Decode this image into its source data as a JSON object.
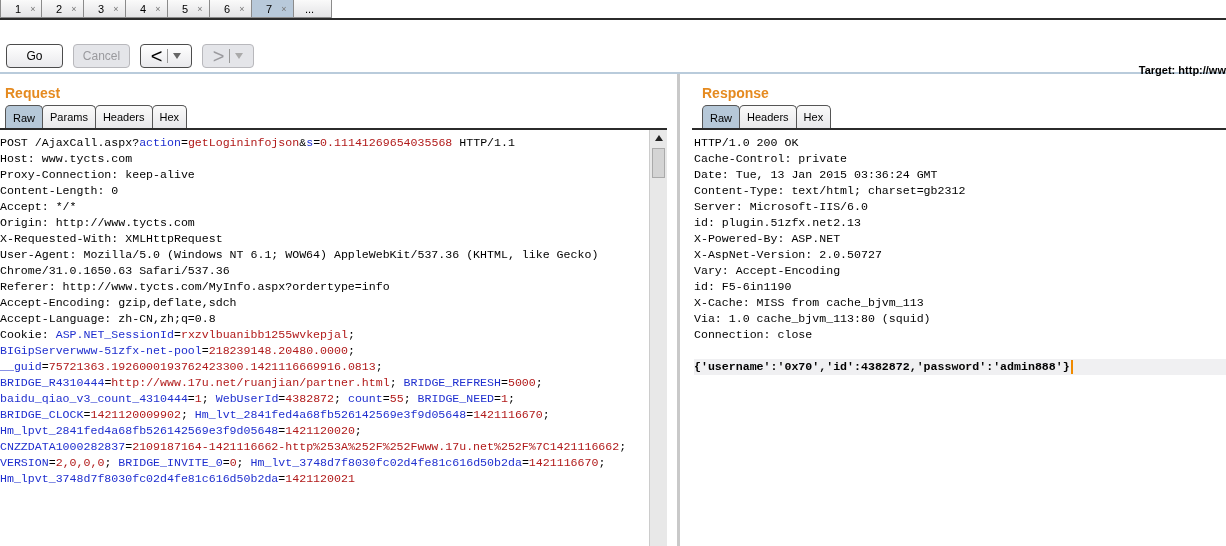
{
  "tabs": [
    {
      "label": "1",
      "close": "×",
      "selected": false
    },
    {
      "label": "2",
      "close": "×",
      "selected": false
    },
    {
      "label": "3",
      "close": "×",
      "selected": false
    },
    {
      "label": "4",
      "close": "×",
      "selected": false
    },
    {
      "label": "5",
      "close": "×",
      "selected": false
    },
    {
      "label": "6",
      "close": "×",
      "selected": false
    },
    {
      "label": "7",
      "close": "×",
      "selected": true
    },
    {
      "label": "...",
      "selected": false
    }
  ],
  "toolbar": {
    "buttons": [
      {
        "kind": "text",
        "label": "Go",
        "disabled": false
      },
      {
        "kind": "text",
        "label": "Cancel",
        "disabled": true
      },
      {
        "kind": "history",
        "label": "<",
        "disabled": false
      },
      {
        "kind": "history",
        "label": ">",
        "disabled": true
      }
    ],
    "target": "Target: http://ww"
  },
  "request": {
    "title": "Request",
    "tabs": [
      {
        "label": "Raw",
        "selected": true
      },
      {
        "label": "Params",
        "selected": false
      },
      {
        "label": "Headers",
        "selected": false
      },
      {
        "label": "Hex",
        "selected": false
      }
    ],
    "lines": [
      [
        {
          "kind": "plain",
          "text": "POST /AjaxCall.aspx?"
        },
        {
          "kind": "name",
          "text": "action"
        },
        {
          "kind": "plain",
          "text": "="
        },
        {
          "kind": "value",
          "text": "getLogininfojson"
        },
        {
          "kind": "plain",
          "text": "&"
        },
        {
          "kind": "name",
          "text": "s"
        },
        {
          "kind": "plain",
          "text": "="
        },
        {
          "kind": "value",
          "text": "0.11141269654035568"
        },
        {
          "kind": "plain",
          "text": " HTTP/1.1"
        }
      ],
      [
        {
          "kind": "plain",
          "text": "Host: www.tycts.com"
        }
      ],
      [
        {
          "kind": "plain",
          "text": "Proxy-Connection: keep-alive"
        }
      ],
      [
        {
          "kind": "plain",
          "text": "Content-Length: 0"
        }
      ],
      [
        {
          "kind": "plain",
          "text": "Accept: */*"
        }
      ],
      [
        {
          "kind": "plain",
          "text": "Origin: http://www.tycts.com"
        }
      ],
      [
        {
          "kind": "plain",
          "text": "X-Requested-With: XMLHttpRequest"
        }
      ],
      [
        {
          "kind": "plain",
          "text": "User-Agent: Mozilla/5.0 (Windows NT 6.1; WOW64) AppleWebKit/537.36 (KHTML, like Gecko)"
        }
      ],
      [
        {
          "kind": "plain",
          "text": "Chrome/31.0.1650.63 Safari/537.36"
        }
      ],
      [
        {
          "kind": "plain",
          "text": "Referer: http://www.tycts.com/MyInfo.aspx?ordertype=info"
        }
      ],
      [
        {
          "kind": "plain",
          "text": "Accept-Encoding: gzip,deflate,sdch"
        }
      ],
      [
        {
          "kind": "plain",
          "text": "Accept-Language: zh-CN,zh;q=0.8"
        }
      ],
      [
        {
          "kind": "plain",
          "text": "Cookie: "
        },
        {
          "kind": "name",
          "text": "ASP.NET_SessionId"
        },
        {
          "kind": "plain",
          "text": "="
        },
        {
          "kind": "value",
          "text": "rxzvlbuanibb1255wvkepjal"
        },
        {
          "kind": "plain",
          "text": ";"
        }
      ],
      [
        {
          "kind": "name",
          "text": "BIGipServerwww-51zfx-net-pool"
        },
        {
          "kind": "plain",
          "text": "="
        },
        {
          "kind": "value",
          "text": "218239148.20480.0000"
        },
        {
          "kind": "plain",
          "text": ";"
        }
      ],
      [
        {
          "kind": "name",
          "text": "__guid"
        },
        {
          "kind": "plain",
          "text": "="
        },
        {
          "kind": "value",
          "text": "75721363.1926000193762423300.1421116669916.0813"
        },
        {
          "kind": "plain",
          "text": ";"
        }
      ],
      [
        {
          "kind": "name",
          "text": "BRIDGE_R4310444"
        },
        {
          "kind": "plain",
          "text": "="
        },
        {
          "kind": "value",
          "text": "http://www.17u.net/ruanjian/partner.html"
        },
        {
          "kind": "plain",
          "text": "; "
        },
        {
          "kind": "name",
          "text": "BRIDGE_REFRESH"
        },
        {
          "kind": "plain",
          "text": "="
        },
        {
          "kind": "value",
          "text": "5000"
        },
        {
          "kind": "plain",
          "text": ";"
        }
      ],
      [
        {
          "kind": "name",
          "text": "baidu_qiao_v3_count_4310444"
        },
        {
          "kind": "plain",
          "text": "="
        },
        {
          "kind": "value",
          "text": "1"
        },
        {
          "kind": "plain",
          "text": "; "
        },
        {
          "kind": "name",
          "text": "WebUserId"
        },
        {
          "kind": "plain",
          "text": "="
        },
        {
          "kind": "value",
          "text": "4382872"
        },
        {
          "kind": "plain",
          "text": "; "
        },
        {
          "kind": "name",
          "text": "count"
        },
        {
          "kind": "plain",
          "text": "="
        },
        {
          "kind": "value",
          "text": "55"
        },
        {
          "kind": "plain",
          "text": "; "
        },
        {
          "kind": "name",
          "text": "BRIDGE_NEED"
        },
        {
          "kind": "plain",
          "text": "="
        },
        {
          "kind": "value",
          "text": "1"
        },
        {
          "kind": "plain",
          "text": ";"
        }
      ],
      [
        {
          "kind": "name",
          "text": "BRIDGE_CLOCK"
        },
        {
          "kind": "plain",
          "text": "="
        },
        {
          "kind": "value",
          "text": "1421120009902"
        },
        {
          "kind": "plain",
          "text": "; "
        },
        {
          "kind": "name",
          "text": "Hm_lvt_2841fed4a68fb526142569e3f9d05648"
        },
        {
          "kind": "plain",
          "text": "="
        },
        {
          "kind": "value",
          "text": "1421116670"
        },
        {
          "kind": "plain",
          "text": ";"
        }
      ],
      [
        {
          "kind": "name",
          "text": "Hm_lpvt_2841fed4a68fb526142569e3f9d05648"
        },
        {
          "kind": "plain",
          "text": "="
        },
        {
          "kind": "value",
          "text": "1421120020"
        },
        {
          "kind": "plain",
          "text": ";"
        }
      ],
      [
        {
          "kind": "name",
          "text": "CNZZDATA1000282837"
        },
        {
          "kind": "plain",
          "text": "="
        },
        {
          "kind": "value",
          "text": "2109187164-1421116662-http%253A%252F%252Fwww.17u.net%252F%7C1421116662"
        },
        {
          "kind": "plain",
          "text": ";"
        }
      ],
      [
        {
          "kind": "name",
          "text": "VERSION"
        },
        {
          "kind": "plain",
          "text": "="
        },
        {
          "kind": "value",
          "text": "2,0,0,0"
        },
        {
          "kind": "plain",
          "text": "; "
        },
        {
          "kind": "name",
          "text": "BRIDGE_INVITE_0"
        },
        {
          "kind": "plain",
          "text": "="
        },
        {
          "kind": "value",
          "text": "0"
        },
        {
          "kind": "plain",
          "text": "; "
        },
        {
          "kind": "name",
          "text": "Hm_lvt_3748d7f8030fc02d4fe81c616d50b2da"
        },
        {
          "kind": "plain",
          "text": "="
        },
        {
          "kind": "value",
          "text": "1421116670"
        },
        {
          "kind": "plain",
          "text": ";"
        }
      ],
      [
        {
          "kind": "name",
          "text": "Hm_lpvt_3748d7f8030fc02d4fe81c616d50b2da"
        },
        {
          "kind": "plain",
          "text": "="
        },
        {
          "kind": "value",
          "text": "1421120021"
        }
      ]
    ]
  },
  "response": {
    "title": "Response",
    "tabs": [
      {
        "label": "Raw",
        "selected": true
      },
      {
        "label": "Headers",
        "selected": false
      },
      {
        "label": "Hex",
        "selected": false
      }
    ],
    "lines": [
      [
        {
          "kind": "plain",
          "text": "HTTP/1.0 200 OK"
        }
      ],
      [
        {
          "kind": "plain",
          "text": "Cache-Control: private"
        }
      ],
      [
        {
          "kind": "plain",
          "text": "Date: Tue, 13 Jan 2015 03:36:24 GMT"
        }
      ],
      [
        {
          "kind": "plain",
          "text": "Content-Type: text/html; charset=gb2312"
        }
      ],
      [
        {
          "kind": "plain",
          "text": "Server: Microsoft-IIS/6.0"
        }
      ],
      [
        {
          "kind": "plain",
          "text": "id: plugin.51zfx.net2.13"
        }
      ],
      [
        {
          "kind": "plain",
          "text": "X-Powered-By: ASP.NET"
        }
      ],
      [
        {
          "kind": "plain",
          "text": "X-AspNet-Version: 2.0.50727"
        }
      ],
      [
        {
          "kind": "plain",
          "text": "Vary: Accept-Encoding"
        }
      ],
      [
        {
          "kind": "plain",
          "text": "id: F5-6in1190"
        }
      ],
      [
        {
          "kind": "plain",
          "text": "X-Cache: MISS from cache_bjvm_113"
        }
      ],
      [
        {
          "kind": "plain",
          "text": "Via: 1.0 cache_bjvm_113:80 (squid)"
        }
      ],
      [
        {
          "kind": "plain",
          "text": "Connection: close"
        }
      ]
    ],
    "body": "{'username':'0x70','id':4382872,'password':'admin888'}"
  }
}
